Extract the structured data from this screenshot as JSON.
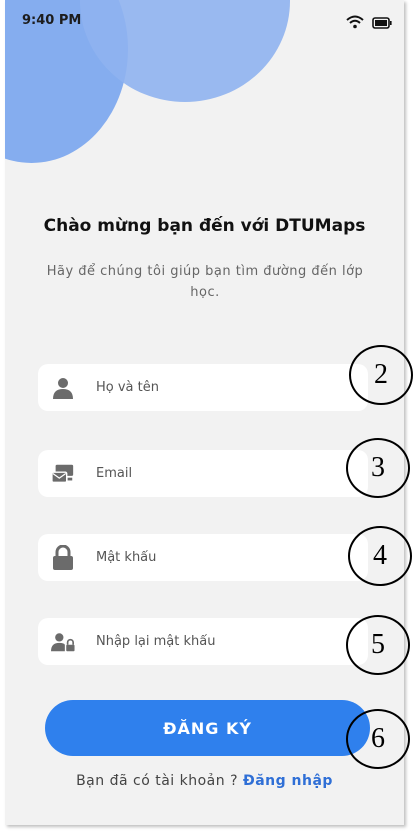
{
  "status": {
    "time": "9:40 PM"
  },
  "welcome": {
    "title": "Chào mừng bạn đến với DTUMaps",
    "subtitle": "Hãy để chúng tôi giúp bạn tìm đường đến lớp học."
  },
  "form": {
    "fullname_placeholder": "Họ và tên",
    "email_placeholder": "Email",
    "password_placeholder": "Mật khẩu",
    "confirm_password_placeholder": "Nhập lại mật khẩu",
    "register_label": "ĐĂNG KÝ"
  },
  "footer": {
    "prompt": "Bạn đã có tài khoản ?",
    "login_label": "Đăng nhập"
  },
  "annotations": [
    "2",
    "3",
    "4",
    "5",
    "6"
  ],
  "colors": {
    "accent": "#2f80ed",
    "circle": "#7ea9ee",
    "background": "#f2f2f2"
  }
}
